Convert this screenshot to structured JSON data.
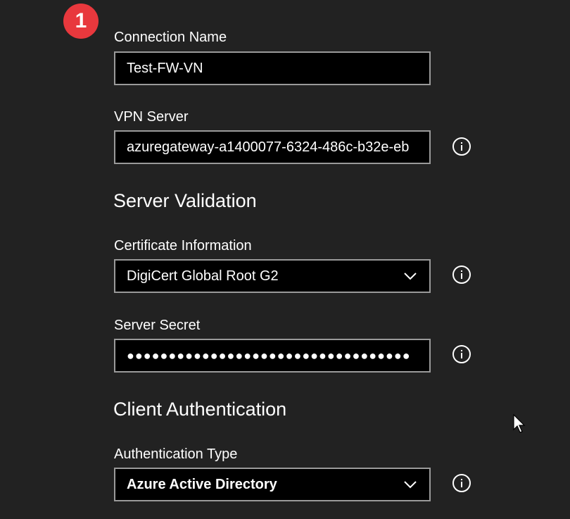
{
  "badge": {
    "number": "1"
  },
  "connection_name": {
    "label": "Connection Name",
    "value": "Test-FW-VN"
  },
  "vpn_server": {
    "label": "VPN Server",
    "value": "azuregateway-a1400077-6324-486c-b32e-eb"
  },
  "server_validation": {
    "title": "Server Validation",
    "certificate": {
      "label": "Certificate Information",
      "selected": "DigiCert Global Root G2"
    },
    "secret": {
      "label": "Server Secret",
      "masked_value": "●●●●●●●●●●●●●●●●●●●●●●●●●●●●●●●●●●"
    }
  },
  "client_authentication": {
    "title": "Client Authentication",
    "auth_type": {
      "label": "Authentication Type",
      "selected": "Azure Active Directory"
    }
  },
  "icons": {
    "info": "info-icon",
    "chevron": "chevron-down-icon",
    "cursor": "mouse-pointer-icon"
  },
  "colors": {
    "background": "#222222",
    "field_background": "#000000",
    "field_border": "#9a9a9a",
    "badge": "#e8383d"
  }
}
